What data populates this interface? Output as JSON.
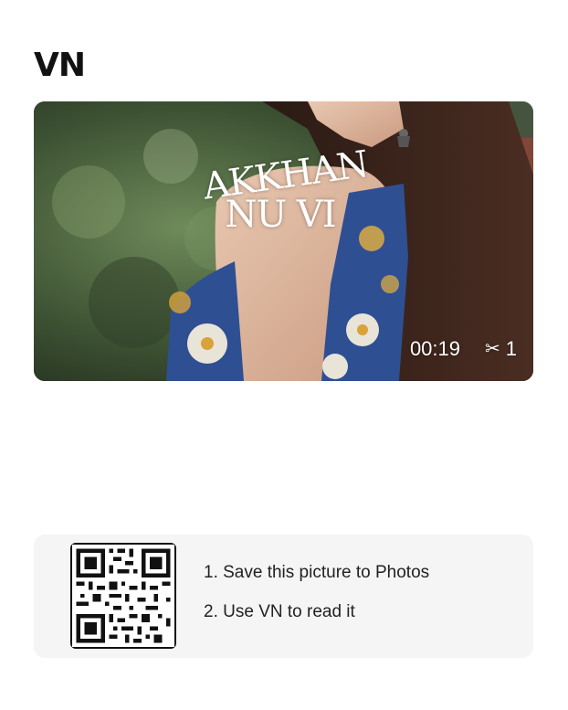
{
  "app": {
    "logo_text": "VN"
  },
  "preview": {
    "overlay_title_line1": "AKKHAN",
    "overlay_title_line2": "NU VI",
    "duration": "00:19",
    "clip_count": "1",
    "clip_icon": "scissors-icon"
  },
  "qr_card": {
    "qr_icon": "qr-code-icon",
    "steps": [
      "1. Save this picture to Photos",
      "2. Use VN to read it"
    ]
  }
}
